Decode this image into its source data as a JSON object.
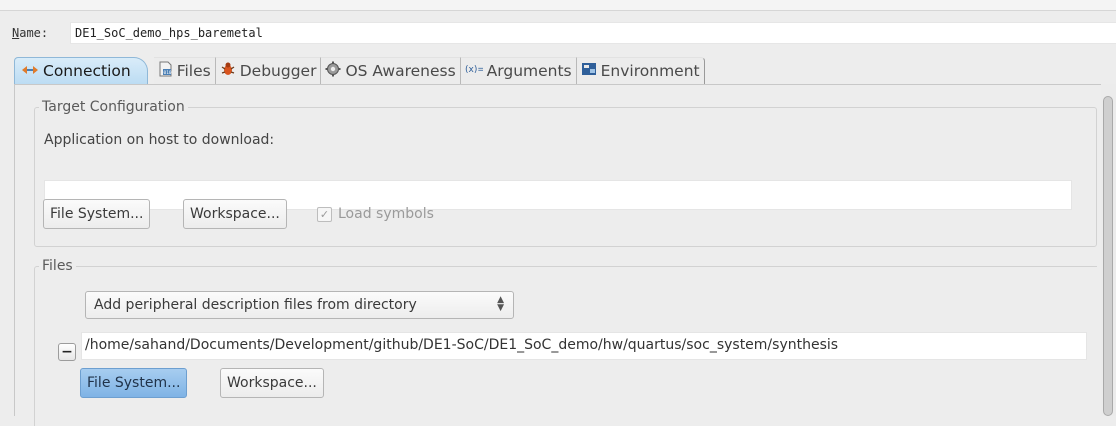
{
  "config": {
    "name_label_prefix": "N",
    "name_label_rest": "ame:",
    "name_value": "DE1_SoC_demo_hps_baremetal"
  },
  "tabs": [
    {
      "label": "Connection",
      "icon": "connection-icon",
      "active": true
    },
    {
      "label": "Files",
      "icon": "files-icon"
    },
    {
      "label": "Debugger",
      "icon": "debugger-icon"
    },
    {
      "label": "OS Awareness",
      "icon": "os-awareness-icon"
    },
    {
      "label": "Arguments",
      "icon": "arguments-icon"
    },
    {
      "label": "Environment",
      "icon": "environment-icon"
    }
  ],
  "target_configuration": {
    "title": "Target Configuration",
    "app_label": "Application on host to download:",
    "app_value": "",
    "file_system_button": "File System...",
    "workspace_button": "Workspace...",
    "load_symbols_label": "Load symbols",
    "load_symbols_checked": true
  },
  "files": {
    "title": "Files",
    "select_value": "Add peripheral description files from directory",
    "path_value": "/home/sahand/Documents/Development/github/DE1-SoC/DE1_SoC_demo/hw/quartus/soc_system/synthesis",
    "file_system_button": "File System...",
    "workspace_button": "Workspace..."
  },
  "colors": {
    "active_tab": "#bcdcf3",
    "primary_button": "#7fb3e5"
  }
}
